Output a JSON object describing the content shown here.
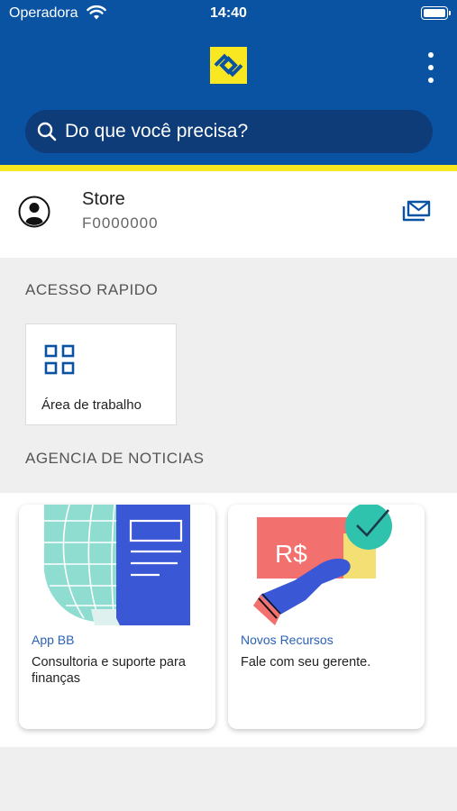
{
  "status_bar": {
    "carrier": "Operadora",
    "time": "14:40"
  },
  "header": {
    "search_placeholder": "Do que você precisa?"
  },
  "profile": {
    "name": "Store",
    "id": "F0000000"
  },
  "quick_access": {
    "title": "ACESSO RAPIDO",
    "items": [
      {
        "label": "Área de trabalho",
        "icon": "grid-icon"
      }
    ]
  },
  "news": {
    "title": "AGENCIA DE NOTICIAS",
    "cards": [
      {
        "tag": "App BB",
        "text": "Consultoria e suporte para finanças"
      },
      {
        "tag": "Novos Recursos",
        "text": "Fale com seu gerente."
      }
    ]
  },
  "colors": {
    "header_blue": "#0a52a2",
    "brand_yellow": "#f9e721",
    "search_bg": "#0d3c78",
    "link_blue": "#2a62b4"
  }
}
